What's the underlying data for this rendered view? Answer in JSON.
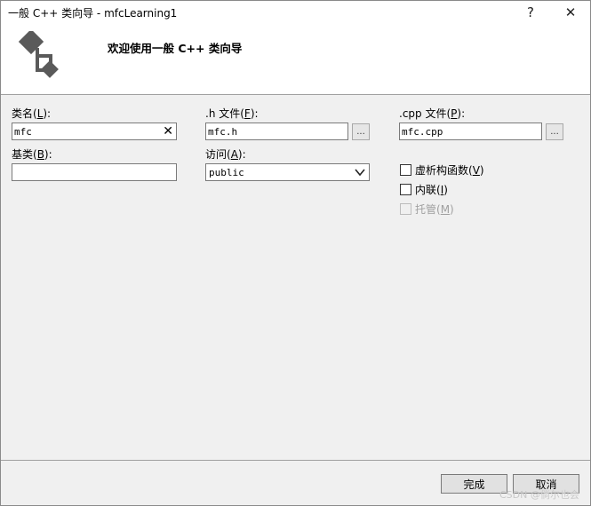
{
  "window": {
    "title": "一般 C++ 类向导 - mfcLearning1",
    "help_glyph": "?",
    "close_glyph": "✕"
  },
  "header": {
    "welcome": "欢迎使用一般 C++ 类向导"
  },
  "class_name": {
    "label_pre": "类名(",
    "label_key": "L",
    "label_post": "):",
    "value": "mfc",
    "clear_glyph": "✕"
  },
  "base_class": {
    "label_pre": "基类(",
    "label_key": "B",
    "label_post": "):",
    "value": ""
  },
  "h_file": {
    "label_pre": ".h 文件(",
    "label_key": "F",
    "label_post": "):",
    "value": "mfc.h",
    "browse": "..."
  },
  "access": {
    "label_pre": "访问(",
    "label_key": "A",
    "label_post": "):",
    "value": "public"
  },
  "cpp_file": {
    "label_pre": ".cpp 文件(",
    "label_key": "P",
    "label_post": "):",
    "value": "mfc.cpp",
    "browse": "..."
  },
  "options": {
    "virtual_dtor": {
      "pre": "虚析构函数(",
      "key": "V",
      "post": ")",
      "checked": false
    },
    "inline": {
      "pre": "内联(",
      "key": "I",
      "post": ")",
      "checked": false
    },
    "managed": {
      "pre": "托管(",
      "key": "M",
      "post": ")",
      "checked": false,
      "disabled": true
    }
  },
  "buttons": {
    "finish": "完成",
    "cancel": "取消"
  },
  "watermark": "CSDN @倘尔也会"
}
